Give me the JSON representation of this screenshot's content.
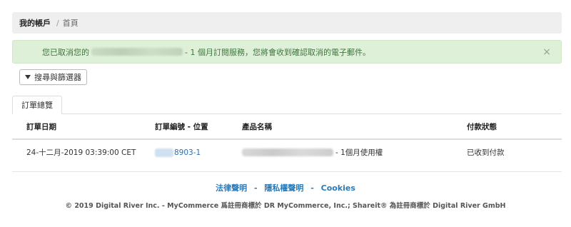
{
  "breadcrumb": {
    "current": "我的帳戶",
    "separator": "/",
    "home": "首頁"
  },
  "alert": {
    "prefix": "您已取消您的",
    "blurred_product": "Malwarebytes for Android (Windows)",
    "suffix": "- 1 個月訂閱服務，您將會收到確認取消的電子郵件。",
    "close": "×"
  },
  "filter": {
    "icon": "funnel-icon",
    "label": "搜尋與篩選器"
  },
  "tabs": [
    {
      "label": "訂單總覽"
    }
  ],
  "table": {
    "headers": [
      "訂單日期",
      "訂單編號 - 位置",
      "產品名稱",
      "付款狀態"
    ],
    "rows": [
      {
        "date": "24-十二月-2019 03:39:00 CET",
        "order_suffix": "8903-1",
        "product_suffix": "- 1個月使用權",
        "status": "已收到付款"
      }
    ]
  },
  "footer": {
    "links": [
      "法律聲明",
      "隱私權聲明",
      "Cookies"
    ],
    "separator": "-",
    "copyright": "© 2019 Digital River Inc.  -  MyCommerce 爲註冊商標於 DR MyCommerce, Inc.; Shareit® 為註冊商標於 Digital River GmbH"
  }
}
